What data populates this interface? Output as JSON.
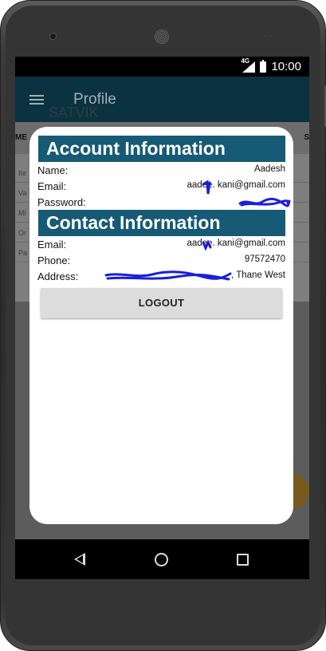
{
  "status_bar": {
    "network": "4G",
    "time": "10:00"
  },
  "app_bar": {
    "menu_icon": "hamburger-menu-icon",
    "title": "Profile"
  },
  "background": {
    "subtitle": "SATVIK",
    "col_left": "ME",
    "col_right": "S",
    "rows": [
      "Ite",
      "Va",
      "Mi",
      "Or",
      "Pa"
    ]
  },
  "dialog": {
    "account_title": "Account Information",
    "account": {
      "name_label": "Name:",
      "name_value": "Aadesh",
      "email_label": "Email:",
      "email_value": "aadee.  kani@gmail.com",
      "password_label": "Password:",
      "password_value": ""
    },
    "contact_title": "Contact Information",
    "contact": {
      "email_label": "Email:",
      "email_value": "aadee.  kani@gmail.com",
      "phone_label": "Phone:",
      "phone_value": "97572470",
      "address_label": "Address:",
      "address_value": ", Thane West"
    },
    "logout_label": "LOGOUT"
  },
  "colors": {
    "app_bar": "#0b3240",
    "section_header": "#175a75",
    "redaction": "#1a1fd8"
  }
}
